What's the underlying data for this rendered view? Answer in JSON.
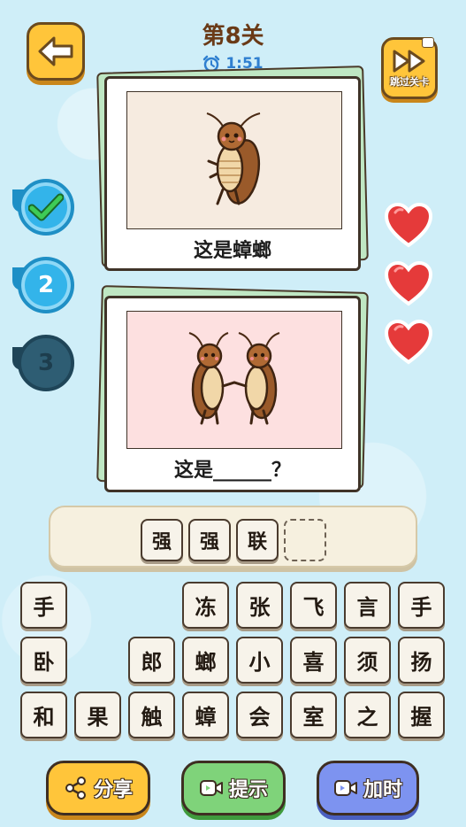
{
  "header": {
    "level_title": "第8关",
    "timer": "1:51",
    "skip_label": "跳过关卡"
  },
  "cards": [
    {
      "caption": "这是蟑螂",
      "image": "single-cockroach"
    },
    {
      "caption": "这是______？",
      "image": "two-cockroaches"
    }
  ],
  "progress": [
    {
      "label": "✓",
      "state": "done"
    },
    {
      "label": "2",
      "state": "current"
    },
    {
      "label": "3",
      "state": "locked"
    }
  ],
  "lives": 3,
  "answer": {
    "slots": [
      "强",
      "强",
      "联",
      ""
    ]
  },
  "keyboard": {
    "row1": [
      "手",
      "",
      "",
      "冻",
      "张",
      "飞",
      "言",
      "手"
    ],
    "row2": [
      "卧",
      "",
      "郎",
      "螂",
      "小",
      "喜",
      "须",
      "扬"
    ],
    "row3": [
      "和",
      "果",
      "触",
      "蟑",
      "会",
      "室",
      "之",
      "握"
    ]
  },
  "buttons": {
    "share": "分享",
    "hint": "提示",
    "add_time": "加时"
  },
  "colors": {
    "primary_yellow": "#ffc53a",
    "hint_green": "#7fd37a",
    "time_blue": "#7d93f0",
    "progress_blue": "#33b4ea",
    "locked_teal": "#2e5d73",
    "heart_red": "#e53a3a"
  }
}
